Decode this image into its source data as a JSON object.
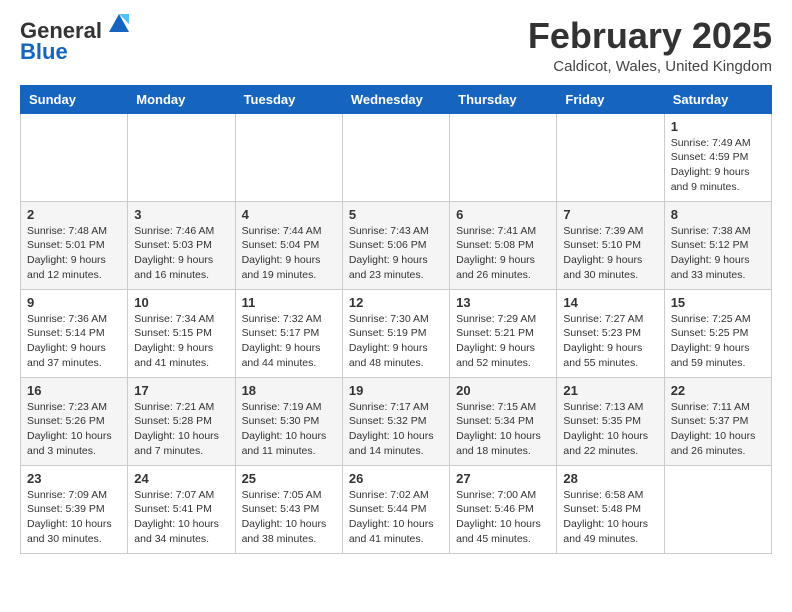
{
  "header": {
    "logo": {
      "line1": "General",
      "line2": "Blue"
    },
    "title": "February 2025",
    "location": "Caldicot, Wales, United Kingdom"
  },
  "weekdays": [
    "Sunday",
    "Monday",
    "Tuesday",
    "Wednesday",
    "Thursday",
    "Friday",
    "Saturday"
  ],
  "weeks": [
    [
      {
        "day": "",
        "info": ""
      },
      {
        "day": "",
        "info": ""
      },
      {
        "day": "",
        "info": ""
      },
      {
        "day": "",
        "info": ""
      },
      {
        "day": "",
        "info": ""
      },
      {
        "day": "",
        "info": ""
      },
      {
        "day": "1",
        "info": "Sunrise: 7:49 AM\nSunset: 4:59 PM\nDaylight: 9 hours and 9 minutes."
      }
    ],
    [
      {
        "day": "2",
        "info": "Sunrise: 7:48 AM\nSunset: 5:01 PM\nDaylight: 9 hours and 12 minutes."
      },
      {
        "day": "3",
        "info": "Sunrise: 7:46 AM\nSunset: 5:03 PM\nDaylight: 9 hours and 16 minutes."
      },
      {
        "day": "4",
        "info": "Sunrise: 7:44 AM\nSunset: 5:04 PM\nDaylight: 9 hours and 19 minutes."
      },
      {
        "day": "5",
        "info": "Sunrise: 7:43 AM\nSunset: 5:06 PM\nDaylight: 9 hours and 23 minutes."
      },
      {
        "day": "6",
        "info": "Sunrise: 7:41 AM\nSunset: 5:08 PM\nDaylight: 9 hours and 26 minutes."
      },
      {
        "day": "7",
        "info": "Sunrise: 7:39 AM\nSunset: 5:10 PM\nDaylight: 9 hours and 30 minutes."
      },
      {
        "day": "8",
        "info": "Sunrise: 7:38 AM\nSunset: 5:12 PM\nDaylight: 9 hours and 33 minutes."
      }
    ],
    [
      {
        "day": "9",
        "info": "Sunrise: 7:36 AM\nSunset: 5:14 PM\nDaylight: 9 hours and 37 minutes."
      },
      {
        "day": "10",
        "info": "Sunrise: 7:34 AM\nSunset: 5:15 PM\nDaylight: 9 hours and 41 minutes."
      },
      {
        "day": "11",
        "info": "Sunrise: 7:32 AM\nSunset: 5:17 PM\nDaylight: 9 hours and 44 minutes."
      },
      {
        "day": "12",
        "info": "Sunrise: 7:30 AM\nSunset: 5:19 PM\nDaylight: 9 hours and 48 minutes."
      },
      {
        "day": "13",
        "info": "Sunrise: 7:29 AM\nSunset: 5:21 PM\nDaylight: 9 hours and 52 minutes."
      },
      {
        "day": "14",
        "info": "Sunrise: 7:27 AM\nSunset: 5:23 PM\nDaylight: 9 hours and 55 minutes."
      },
      {
        "day": "15",
        "info": "Sunrise: 7:25 AM\nSunset: 5:25 PM\nDaylight: 9 hours and 59 minutes."
      }
    ],
    [
      {
        "day": "16",
        "info": "Sunrise: 7:23 AM\nSunset: 5:26 PM\nDaylight: 10 hours and 3 minutes."
      },
      {
        "day": "17",
        "info": "Sunrise: 7:21 AM\nSunset: 5:28 PM\nDaylight: 10 hours and 7 minutes."
      },
      {
        "day": "18",
        "info": "Sunrise: 7:19 AM\nSunset: 5:30 PM\nDaylight: 10 hours and 11 minutes."
      },
      {
        "day": "19",
        "info": "Sunrise: 7:17 AM\nSunset: 5:32 PM\nDaylight: 10 hours and 14 minutes."
      },
      {
        "day": "20",
        "info": "Sunrise: 7:15 AM\nSunset: 5:34 PM\nDaylight: 10 hours and 18 minutes."
      },
      {
        "day": "21",
        "info": "Sunrise: 7:13 AM\nSunset: 5:35 PM\nDaylight: 10 hours and 22 minutes."
      },
      {
        "day": "22",
        "info": "Sunrise: 7:11 AM\nSunset: 5:37 PM\nDaylight: 10 hours and 26 minutes."
      }
    ],
    [
      {
        "day": "23",
        "info": "Sunrise: 7:09 AM\nSunset: 5:39 PM\nDaylight: 10 hours and 30 minutes."
      },
      {
        "day": "24",
        "info": "Sunrise: 7:07 AM\nSunset: 5:41 PM\nDaylight: 10 hours and 34 minutes."
      },
      {
        "day": "25",
        "info": "Sunrise: 7:05 AM\nSunset: 5:43 PM\nDaylight: 10 hours and 38 minutes."
      },
      {
        "day": "26",
        "info": "Sunrise: 7:02 AM\nSunset: 5:44 PM\nDaylight: 10 hours and 41 minutes."
      },
      {
        "day": "27",
        "info": "Sunrise: 7:00 AM\nSunset: 5:46 PM\nDaylight: 10 hours and 45 minutes."
      },
      {
        "day": "28",
        "info": "Sunrise: 6:58 AM\nSunset: 5:48 PM\nDaylight: 10 hours and 49 minutes."
      },
      {
        "day": "",
        "info": ""
      }
    ]
  ]
}
